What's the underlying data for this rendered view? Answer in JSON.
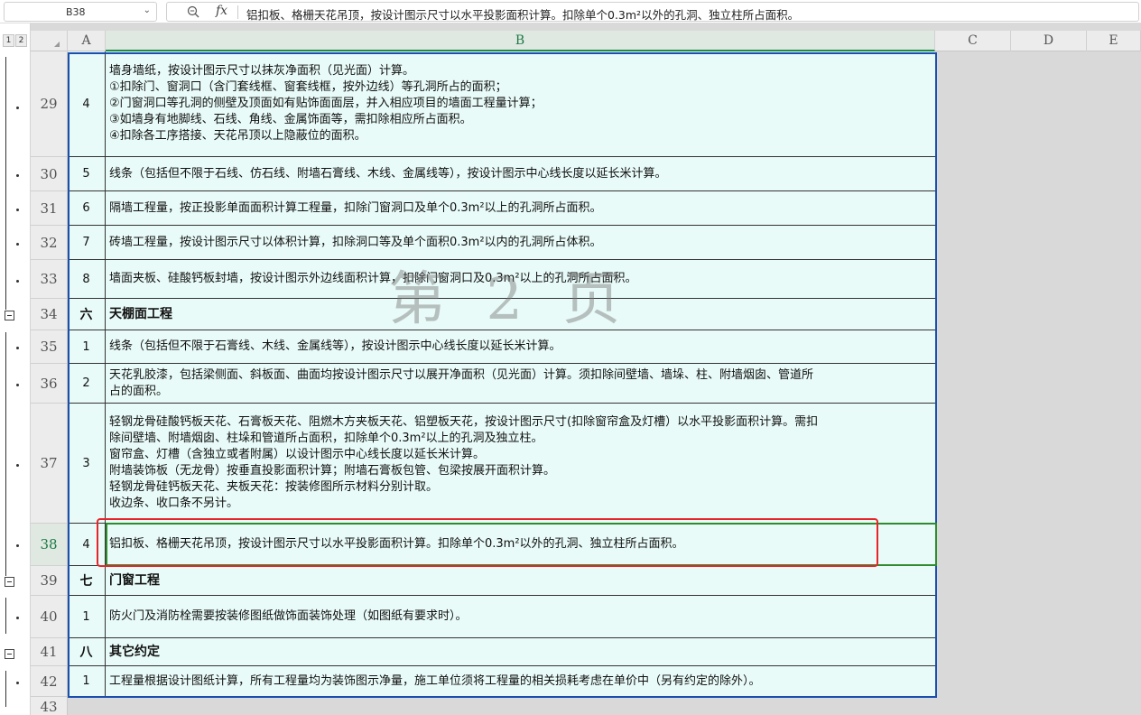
{
  "formula_bar": {
    "cell_ref": "B38",
    "fx_label": "fx",
    "formula": "铝扣板、格栅天花吊顶，按设计图示尺寸以水平投影面积计算。扣除单个0.3m²以外的孔洞、独立柱所占面积。"
  },
  "outline_levels": [
    "1",
    "2"
  ],
  "columns": [
    "A",
    "B",
    "C",
    "D",
    "E"
  ],
  "watermark": "第 2 页",
  "rows": [
    {
      "num": "29",
      "a": "4",
      "b": "墙身墙纸，按设计图示尺寸以抹灰净面积（见光面）计算。\n①扣除门、窗洞口（含门套线框、窗套线框，按外边线）等孔洞所占的面积；\n②门窗洞口等孔洞的侧壁及顶面如有贴饰面面层，并入相应项目的墙面工程量计算；\n③如墙身有地脚线、石线、角线、金属饰面等，需扣除相应所占面积。\n④扣除各工序搭接、天花吊顶以上隐蔽位的面积。"
    },
    {
      "num": "30",
      "a": "5",
      "b": "线条（包括但不限于石线、仿石线、附墙石膏线、木线、金属线等），按设计图示中心线长度以延长米计算。"
    },
    {
      "num": "31",
      "a": "6",
      "b": "隔墙工程量，按正投影单面面积计算工程量，扣除门窗洞口及单个0.3m²以上的孔洞所占面积。"
    },
    {
      "num": "32",
      "a": "7",
      "b": "砖墙工程量，按设计图示尺寸以体积计算，扣除洞口等及单个面积0.3m²以内的孔洞所占体积。"
    },
    {
      "num": "33",
      "a": "8",
      "b": "墙面夹板、硅酸钙板封墙，按设计图示外边线面积计算，扣除门窗洞口及0.3m²以上的孔洞所占面积。"
    },
    {
      "num": "34",
      "a": "六",
      "b": "天棚面工程"
    },
    {
      "num": "35",
      "a": "1",
      "b": "线条（包括但不限于石膏线、木线、金属线等），按设计图示中心线长度以延长米计算。"
    },
    {
      "num": "36",
      "a": "2",
      "b": "天花乳胶漆，包括梁侧面、斜板面、曲面均按设计图示尺寸以展开净面积（见光面）计算。须扣除间壁墙、墙垛、柱、附墙烟囱、管道所\n占的面积。"
    },
    {
      "num": "37",
      "a": "3",
      "b": "轻钢龙骨硅酸钙板天花、石膏板天花、阻燃木方夹板天花、铝塑板天花，按设计图示尺寸(扣除窗帘盒及灯槽）以水平投影面积计算。需扣\n除间壁墙、附墙烟囱、柱垛和管道所占面积，扣除单个0.3m²以上的孔洞及独立柱。\n窗帘盒、灯槽（含独立或者附属）以设计图示中心线长度以延长米计算。\n附墙装饰板（无龙骨）按垂直投影面积计算；附墙石膏板包管、包梁按展开面积计算。\n轻钢龙骨硅钙板天花、夹板天花：按装修图所示材料分别计取。\n收边条、收口条不另计。"
    },
    {
      "num": "38",
      "a": "4",
      "b": "铝扣板、格栅天花吊顶，按设计图示尺寸以水平投影面积计算。扣除单个0.3m²以外的孔洞、独立柱所占面积。"
    },
    {
      "num": "39",
      "a": "七",
      "b": "门窗工程"
    },
    {
      "num": "40",
      "a": "1",
      "b": "防火门及消防栓需要按装修图纸做饰面装饰处理（如图纸有要求时）。"
    },
    {
      "num": "41",
      "a": "八",
      "b": "其它约定"
    },
    {
      "num": "42",
      "a": "1",
      "b": "工程量根据设计图纸计算，所有工程量均为装饰图示净量，施工单位须将工程量的相关损耗考虑在单价中（另有约定的除外）。"
    },
    {
      "num": "43",
      "a": "",
      "b": ""
    }
  ]
}
